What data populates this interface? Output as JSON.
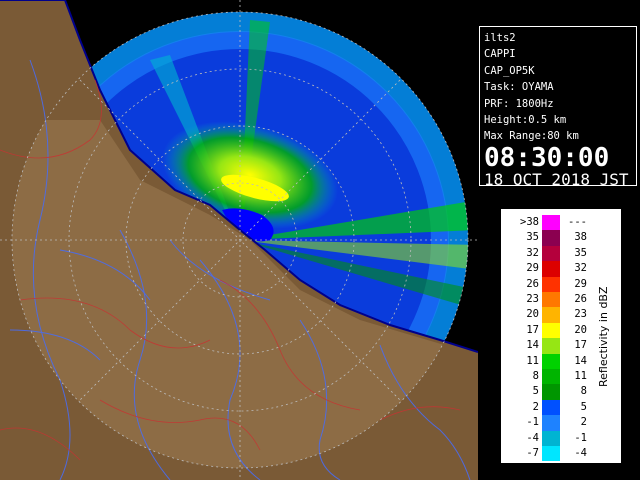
{
  "info": {
    "radar": "ilts2",
    "product": "CAPPI",
    "code": "CAP_OP5K",
    "task": "Task: OYAMA",
    "prf": "PRF: 1800Hz",
    "height": "Height:0.5 km",
    "max_range": "Max Range:80 km",
    "time": "08:30:00",
    "date": "18 OCT 2018 JST"
  },
  "legend": {
    "title": "Reflectivity in dBZ",
    "rows": [
      {
        "lo": ">38",
        "hi": "---",
        "color": "#ff00ff"
      },
      {
        "lo": "35",
        "hi": "38",
        "color": "#8b0050"
      },
      {
        "lo": "32",
        "hi": "35",
        "color": "#b4003c"
      },
      {
        "lo": "29",
        "hi": "32",
        "color": "#dc0000"
      },
      {
        "lo": "26",
        "hi": "29",
        "color": "#ff3200"
      },
      {
        "lo": "23",
        "hi": "26",
        "color": "#ff7800"
      },
      {
        "lo": "20",
        "hi": "23",
        "color": "#ffb400"
      },
      {
        "lo": "17",
        "hi": "20",
        "color": "#ffff00"
      },
      {
        "lo": "14",
        "hi": "17",
        "color": "#96e614"
      },
      {
        "lo": "11",
        "hi": "14",
        "color": "#00d200"
      },
      {
        "lo": "8",
        "hi": "11",
        "color": "#00b400"
      },
      {
        "lo": "5",
        "hi": "8",
        "color": "#009600"
      },
      {
        "lo": "2",
        "hi": "5",
        "color": "#0050ff"
      },
      {
        "lo": "-1",
        "hi": "2",
        "color": "#1e82ff"
      },
      {
        "lo": "-4",
        "hi": "-1",
        "color": "#00b4d2"
      },
      {
        "lo": "-7",
        "hi": "-4",
        "color": "#00e6ff"
      }
    ]
  }
}
